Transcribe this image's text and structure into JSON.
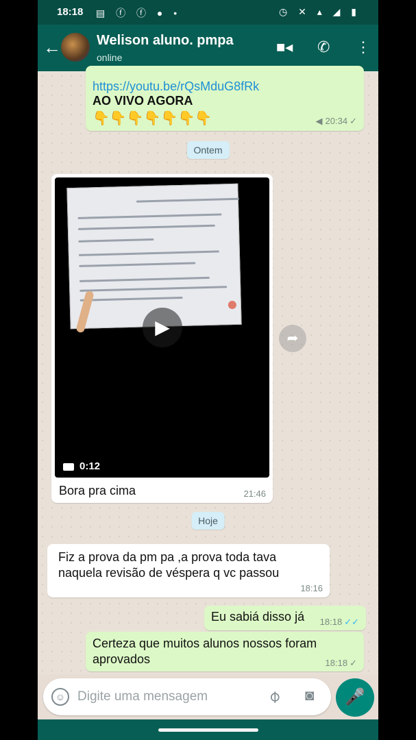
{
  "status_bar": {
    "time": "18:18",
    "left_icons": "▤ ⓕ ⓕ ● •",
    "right_icons": "◷ ✕ ▴ ◢ ▮"
  },
  "header": {
    "contact_name": "Welison aluno. pmpa",
    "contact_status": "online",
    "icons": [
      "back-arrow-icon",
      "video-call-icon",
      "phone-icon",
      "more-options-icon"
    ]
  },
  "messages": [
    {
      "type": "out",
      "link": "https://youtu.be/rQsMduG8fRk",
      "text": "AO VIVO AGORA",
      "emoji": "👇👇👇👇👇👇👇",
      "time": "20:34",
      "tick": "✓"
    },
    {
      "type": "day",
      "text": "Ontem"
    },
    {
      "type": "in-video",
      "duration": "0:12",
      "caption": "Bora pra cima",
      "time": "21:46"
    },
    {
      "type": "day",
      "text": "Hoje"
    },
    {
      "type": "in",
      "text": "Fiz a prova da pm pa ,a prova toda tava naquela revisão de véspera q vc passou",
      "time": "18:16"
    },
    {
      "type": "out",
      "text": "Eu sabiá disso já",
      "time": "18:18",
      "tick": "✓✓"
    },
    {
      "type": "out",
      "text": "Certeza que muitos alunos nossos foram aprovados",
      "time": "18:18",
      "tick": "✓"
    }
  ],
  "input": {
    "placeholder": "Digite uma mensagem"
  },
  "colors": {
    "header": "#075e54",
    "outgoing_bubble": "#dcf8c6",
    "incoming_bubble": "#ffffff",
    "mic_button": "#00897b",
    "read_tick": "#34b7f1"
  }
}
